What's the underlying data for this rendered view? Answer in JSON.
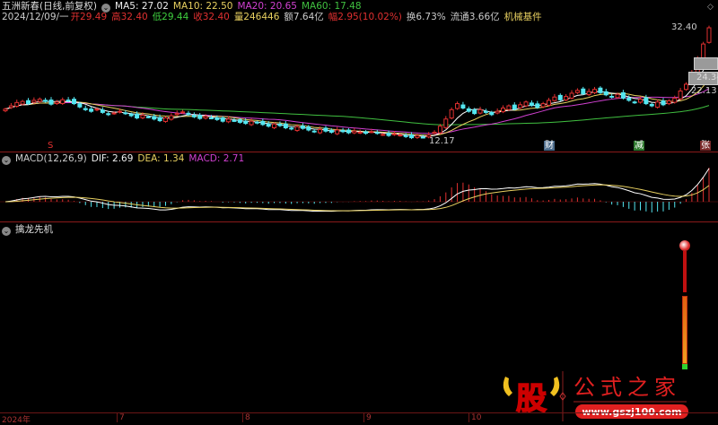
{
  "header": {
    "title": "五洲新春(日线,前复权)",
    "ma5": "MA5: 27.02",
    "ma10": "MA10: 22.50",
    "ma20": "MA20: 20.65",
    "ma60": "MA60: 17.48",
    "date": "2024/12/09/一",
    "open": "开29.49",
    "high": "高32.40",
    "low": "低29.44",
    "close": "收32.40",
    "volume": "量246446",
    "amount": "额7.64亿",
    "change": "幅2.95(10.02%)",
    "turnover": "换6.73%",
    "float": "流通3.66亿",
    "industry": "机械基件"
  },
  "price_labels": {
    "high": "32.40",
    "mid1": "24.34",
    "mid2": "22.13",
    "low": "12.17"
  },
  "signals": [
    {
      "label": "S",
      "color": "#e03030"
    },
    {
      "label": "财",
      "color": "#6fa8d8"
    },
    {
      "label": "减",
      "color": "#3fbf3f"
    },
    {
      "label": "张",
      "color": "#e06060"
    }
  ],
  "macd": {
    "title": "MACD(12,26,9)",
    "dif": "DIF: 2.69",
    "dea": "DEA: 1.34",
    "macd": "MACD: 2.71"
  },
  "indicator": {
    "title": "擒龙先机"
  },
  "axis": {
    "labels": [
      "2024年",
      "7",
      "8",
      "9",
      "10"
    ]
  },
  "watermark": {
    "logo": "股",
    "name": "公式之家",
    "url": "www.gszj100.com"
  },
  "colors": {
    "up": "#e03030",
    "down": "#54e6f0",
    "ma5": "#ffffff",
    "ma10": "#e8d060",
    "ma20": "#d040d0",
    "ma60": "#40c040"
  },
  "chart_data": {
    "type": "candlestick",
    "price_range": [
      12.17,
      32.4
    ],
    "closes": [
      17.6,
      18.2,
      18.8,
      19.0,
      18.6,
      19.2,
      19.4,
      19.0,
      18.5,
      18.9,
      19.3,
      19.1,
      18.6,
      18.0,
      17.5,
      17.2,
      17.6,
      17.0,
      16.6,
      16.9,
      17.2,
      16.8,
      16.4,
      16.0,
      16.5,
      16.2,
      15.8,
      15.5,
      16.0,
      16.4,
      16.8,
      17.1,
      16.6,
      16.2,
      15.9,
      16.3,
      16.0,
      15.7,
      15.4,
      15.8,
      15.5,
      15.2,
      15.0,
      15.4,
      15.1,
      14.8,
      14.5,
      14.9,
      14.6,
      14.2,
      14.0,
      14.4,
      14.1,
      13.8,
      13.5,
      13.9,
      13.6,
      13.4,
      13.8,
      13.5,
      13.3,
      13.6,
      13.4,
      13.2,
      13.5,
      13.2,
      13.0,
      12.8,
      13.1,
      12.9,
      12.6,
      12.4,
      12.8,
      12.5,
      12.9,
      13.4,
      14.5,
      15.8,
      17.5,
      18.6,
      17.8,
      17.2,
      16.8,
      17.5,
      17.0,
      16.6,
      17.2,
      17.8,
      18.2,
      17.6,
      18.4,
      18.9,
      18.3,
      17.9,
      18.6,
      19.2,
      19.8,
      19.3,
      19.9,
      20.5,
      21.0,
      20.4,
      20.8,
      21.2,
      20.6,
      20.2,
      19.8,
      20.3,
      19.6,
      19.2,
      18.8,
      19.4,
      18.6,
      18.2,
      18.9,
      18.4,
      19.1,
      19.6,
      20.9,
      22.13,
      24.3,
      26.7,
      29.45,
      32.4
    ],
    "indicator_value": 0.95
  }
}
